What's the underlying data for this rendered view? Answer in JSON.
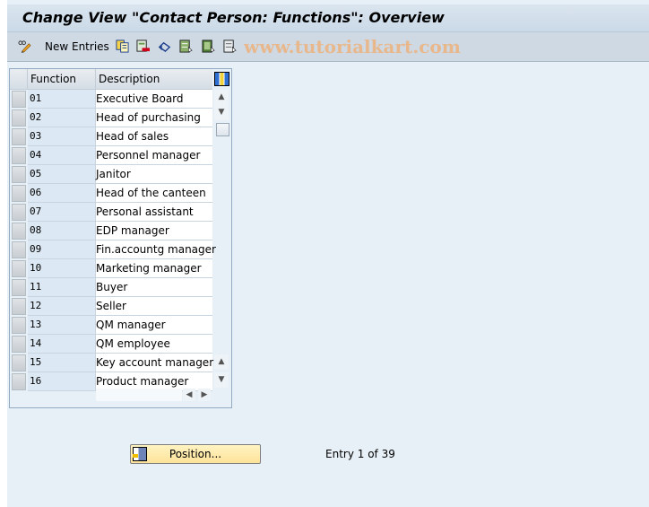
{
  "title": "Change View \"Contact Person: Functions\": Overview",
  "toolbar": {
    "new_entries_label": "New Entries",
    "icons": [
      "edit-glasses-pencil-icon",
      "copy-icon",
      "delete-icon",
      "undo-icon",
      "select-all-icon",
      "select-block-icon",
      "deselect-all-icon"
    ],
    "watermark": "www.tutorialkart.com"
  },
  "table": {
    "columns": [
      "Function",
      "Description"
    ],
    "rows": [
      {
        "function": "01",
        "description": "Executive Board"
      },
      {
        "function": "02",
        "description": "Head of purchasing"
      },
      {
        "function": "03",
        "description": "Head of sales"
      },
      {
        "function": "04",
        "description": "Personnel manager"
      },
      {
        "function": "05",
        "description": "Janitor"
      },
      {
        "function": "06",
        "description": "Head of the canteen"
      },
      {
        "function": "07",
        "description": "Personal assistant"
      },
      {
        "function": "08",
        "description": "EDP manager"
      },
      {
        "function": "09",
        "description": "Fin.accountg manager"
      },
      {
        "function": "10",
        "description": "Marketing manager"
      },
      {
        "function": "11",
        "description": "Buyer"
      },
      {
        "function": "12",
        "description": "Seller"
      },
      {
        "function": "13",
        "description": "QM manager"
      },
      {
        "function": "14",
        "description": "QM employee"
      },
      {
        "function": "15",
        "description": "Key account manager"
      },
      {
        "function": "16",
        "description": "Product manager"
      }
    ]
  },
  "footer": {
    "position_button_label": "Position...",
    "entry_text": "Entry 1 of 39"
  }
}
